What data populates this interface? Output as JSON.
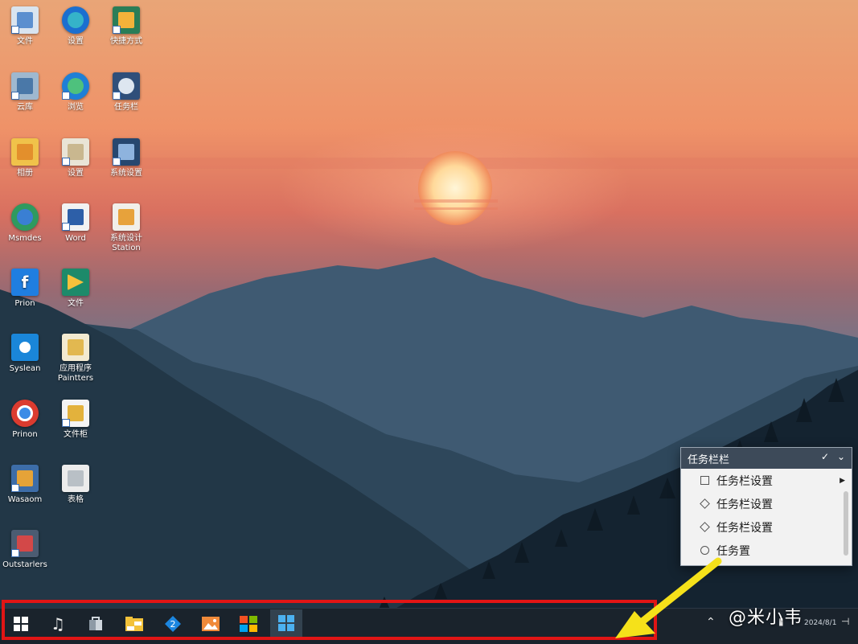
{
  "desktop": {
    "icons": [
      {
        "label": "文件",
        "icon": "folder-icon"
      },
      {
        "label": "设置",
        "icon": "edge-logo-icon"
      },
      {
        "label": "快捷方式",
        "icon": "windows-logo-icon"
      },
      {
        "label": "云库",
        "icon": "monitor-icon"
      },
      {
        "label": "浏览",
        "icon": "edge-browser-icon"
      },
      {
        "label": "任务栏",
        "icon": "settings-gear-icon"
      },
      {
        "label": "相册",
        "icon": "chart-folder-icon"
      },
      {
        "label": "设置",
        "icon": "notepad-icon"
      },
      {
        "label": "系统设置",
        "icon": "windows-tile-icon"
      },
      {
        "label": "Msmdes",
        "icon": "edge-globe-icon"
      },
      {
        "label": "Word",
        "icon": "calendar-word-icon"
      },
      {
        "label": "系统设计 Station",
        "icon": "windows-flag-icon"
      },
      {
        "label": "Prion",
        "icon": "facebook-icon"
      },
      {
        "label": "文件",
        "icon": "play-store-icon"
      },
      {
        "label": "Syslean",
        "icon": "blue-app-icon"
      },
      {
        "label": "应用程序 Paintters",
        "icon": "notes-icon"
      },
      {
        "label": "Prinon",
        "icon": "chrome-icon"
      },
      {
        "label": "文件柜",
        "icon": "chart-doc-icon"
      },
      {
        "label": "Wasaom",
        "icon": "computer-icon"
      },
      {
        "label": "表格",
        "icon": "document-icon"
      },
      {
        "label": "Outstarlers",
        "icon": "app-cube-icon"
      }
    ]
  },
  "popup": {
    "title": "任务栏栏",
    "pin_icon": "pin-icon",
    "chevron_icon": "chevron-down-icon",
    "items": [
      {
        "label": "任务栏设置",
        "mark": "checkbox",
        "submenu": true
      },
      {
        "label": "任务栏设置",
        "mark": "diamond",
        "submenu": false
      },
      {
        "label": "任务栏设置",
        "mark": "diamond",
        "submenu": false
      },
      {
        "label": "任务置",
        "mark": "circle",
        "submenu": false
      }
    ]
  },
  "taskbar": {
    "buttons": [
      {
        "name": "start",
        "icon": "windows-start-icon",
        "state": "normal"
      },
      {
        "name": "music",
        "icon": "music-note-icon",
        "state": "normal"
      },
      {
        "name": "store",
        "icon": "store-bag-icon",
        "state": "normal"
      },
      {
        "name": "file-explorer",
        "icon": "folder-icon",
        "state": "normal"
      },
      {
        "name": "sync",
        "icon": "sync-icon",
        "state": "normal"
      },
      {
        "name": "photos",
        "icon": "photos-icon",
        "state": "running"
      },
      {
        "name": "microsoft-store",
        "icon": "ms-store-icon",
        "state": "running"
      },
      {
        "name": "windows-app",
        "icon": "windows-logo-icon",
        "state": "active"
      }
    ],
    "tray": {
      "chevron_icon": "chevron-up-icon",
      "clock_text": "2024/8/1"
    }
  },
  "watermark": "@米小韦",
  "colors": {
    "highlight": "#e11515",
    "arrow": "#f5e11a",
    "taskbar": "#1a232c",
    "popup_header": "#3d4a59"
  }
}
